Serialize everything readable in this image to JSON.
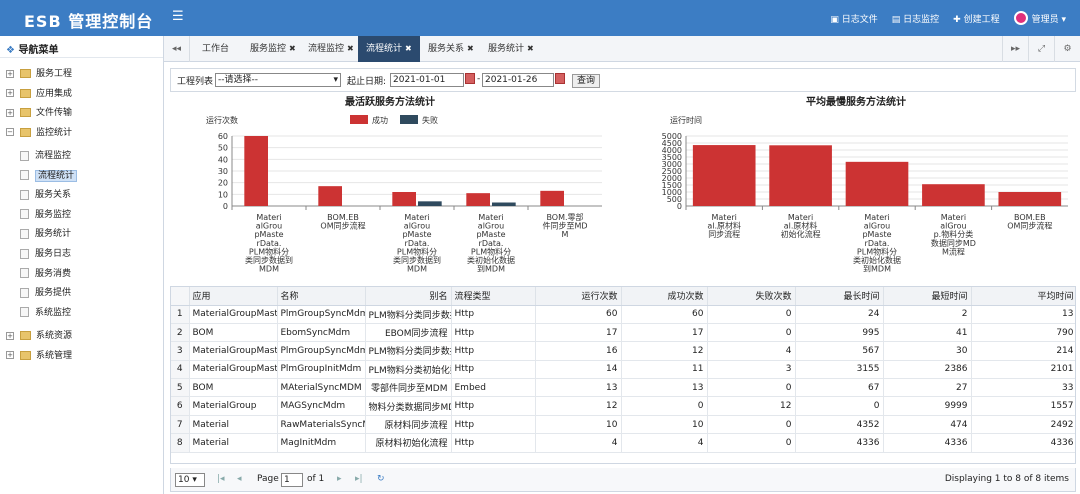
{
  "header": {
    "brand": "ESB 管理控制台",
    "menu_icon": "hamburger-icon",
    "nav": [
      "日志文件",
      "日志监控",
      "创建工程"
    ],
    "user": "管理员"
  },
  "sidebar": {
    "title": "导航菜单",
    "groups": [
      {
        "label": "服务工程",
        "expanded": false
      },
      {
        "label": "应用集成",
        "expanded": false
      },
      {
        "label": "文件传输",
        "expanded": false
      },
      {
        "label": "监控统计",
        "expanded": true
      }
    ],
    "children": [
      "流程监控",
      "流程统计",
      "服务关系",
      "服务监控",
      "服务统计",
      "服务日志",
      "服务消费",
      "服务提供",
      "系统监控"
    ],
    "selected": "流程统计",
    "groups_after": [
      {
        "label": "系统资源",
        "expanded": false
      },
      {
        "label": "系统管理",
        "expanded": false
      }
    ]
  },
  "tabs": [
    "工作台",
    "服务监控",
    "流程监控",
    "流程统计",
    "服务关系",
    "服务统计"
  ],
  "active_tab": "流程统计",
  "filter": {
    "project_label": "工程列表",
    "project_value": "--请选择--",
    "date_label": "起止日期:",
    "start": "2021-01-01",
    "sep": "-",
    "end": "2021-01-26",
    "query": "查询"
  },
  "chart_data": [
    {
      "type": "bar",
      "title": "最活跃服务方法统计",
      "ylabel": "运行次数",
      "ylim": [
        0,
        60
      ],
      "yticks": [
        0,
        10,
        20,
        30,
        40,
        50,
        60
      ],
      "categories": [
        [
          "Materi",
          "alGrou",
          "pMaste",
          "rData.",
          "PLM物料分",
          "类同步数据到",
          "MDM"
        ],
        [
          "BOM.EB",
          "OM同步流程"
        ],
        [
          "Materi",
          "alGrou",
          "pMaste",
          "rData.",
          "PLM物料分",
          "类同步数据到",
          "MDM"
        ],
        [
          "Materi",
          "alGrou",
          "pMaste",
          "rData.",
          "PLM物料分",
          "类初始化数据",
          "到MDM"
        ],
        [
          "BOM.零部",
          "件同步至MD",
          "M"
        ]
      ],
      "series": [
        {
          "name": "成功",
          "color": "#cc3333",
          "values": [
            60,
            17,
            12,
            11,
            13
          ]
        },
        {
          "name": "失败",
          "color": "#2f4a5e",
          "values": [
            0,
            0,
            4,
            3,
            0
          ]
        }
      ]
    },
    {
      "type": "bar",
      "title": "平均最慢服务方法统计",
      "ylabel": "运行时间",
      "ylim": [
        0,
        5000
      ],
      "yticks": [
        0,
        500,
        1000,
        1500,
        2000,
        2500,
        3000,
        3500,
        4000,
        4500,
        5000
      ],
      "categories": [
        [
          "Materi",
          "al.原材料",
          "同步流程"
        ],
        [
          "Materi",
          "al.原材料",
          "初始化流程"
        ],
        [
          "Materi",
          "alGrou",
          "pMaste",
          "rData.",
          "PLM物料分",
          "类初始化数据",
          "到MDM"
        ],
        [
          "Materi",
          "alGrou",
          "p.物料分类",
          "数据同步MD",
          "M流程"
        ],
        [
          "BOM.EB",
          "OM同步流程"
        ]
      ],
      "series": [
        {
          "color": "#cc3333",
          "values": [
            4352,
            4336,
            3155,
            1557,
            1000
          ]
        }
      ]
    }
  ],
  "table": {
    "columns": [
      "",
      "应用",
      "名称",
      "别名",
      "流程类型",
      "运行次数",
      "成功次数",
      "失败次数",
      "最长时间",
      "最短时间",
      "平均时间"
    ],
    "rows": [
      [
        "1",
        "MaterialGroupMaste",
        "PlmGroupSyncMdm",
        "PLM物料分类同步数据",
        "Http",
        "60",
        "60",
        "0",
        "24",
        "2",
        "13"
      ],
      [
        "2",
        "BOM",
        "EbomSyncMdm",
        "EBOM同步流程",
        "Http",
        "17",
        "17",
        "0",
        "995",
        "41",
        "790"
      ],
      [
        "3",
        "MaterialGroupMaste",
        "PlmGroupSyncMdm",
        "PLM物料分类同步数据",
        "Http",
        "16",
        "12",
        "4",
        "567",
        "30",
        "214"
      ],
      [
        "4",
        "MaterialGroupMaste",
        "PlmGroupInitMdm",
        "PLM物料分类初始化数",
        "Http",
        "14",
        "11",
        "3",
        "3155",
        "2386",
        "2101"
      ],
      [
        "5",
        "BOM",
        "MAterialSyncMDM",
        "零部件同步至MDM",
        "Embed",
        "13",
        "13",
        "0",
        "67",
        "27",
        "33"
      ],
      [
        "6",
        "MaterialGroup",
        "MAGSyncMdm",
        "物料分类数据同步MD",
        "Http",
        "12",
        "0",
        "12",
        "0",
        "9999",
        "1557"
      ],
      [
        "7",
        "Material",
        "RawMaterialsSyncM",
        "原材料同步流程",
        "Http",
        "10",
        "10",
        "0",
        "4352",
        "474",
        "2492"
      ],
      [
        "8",
        "Material",
        "MagInitMdm",
        "原材料初始化流程",
        "Http",
        "4",
        "4",
        "0",
        "4336",
        "4336",
        "4336"
      ]
    ]
  },
  "pager": {
    "page_size": "10",
    "page_label": "Page",
    "page": "1",
    "of": "of 1",
    "summary": "Displaying 1 to 8 of 8 items"
  }
}
